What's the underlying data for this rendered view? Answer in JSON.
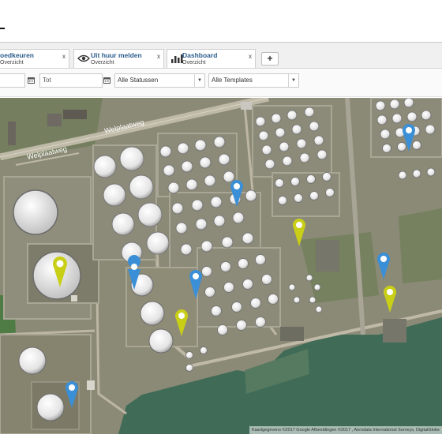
{
  "tabs": [
    {
      "title": "oedkeuren",
      "subtitle": "Overzicht",
      "icon": "eye-icon"
    },
    {
      "title": "Uit huur melden",
      "subtitle": "Overzicht",
      "icon": "eye-icon"
    },
    {
      "title": "Dashboard",
      "subtitle": "Overzicht",
      "icon": "bar-chart-icon"
    }
  ],
  "tab_close_label": "x",
  "add_tab_label": "+",
  "filters": {
    "date_to_placeholder": "Tot",
    "status_select": "Alle Statussen",
    "template_select": "Alle Templates"
  },
  "map": {
    "road_labels": [
      "Welplaatweg",
      "Welplaatweg"
    ],
    "attribution": "Kaartgegevens ©2017 Google Afbeeldingen ©2017 , Aerodata International Surveys, DigitalGlobe",
    "marker_colors": {
      "blue": "#3a8fd6",
      "yellow": "#c9cf17"
    }
  },
  "colors": {
    "tab_title": "#2c5d8c",
    "accent": "#3a8fd6"
  }
}
